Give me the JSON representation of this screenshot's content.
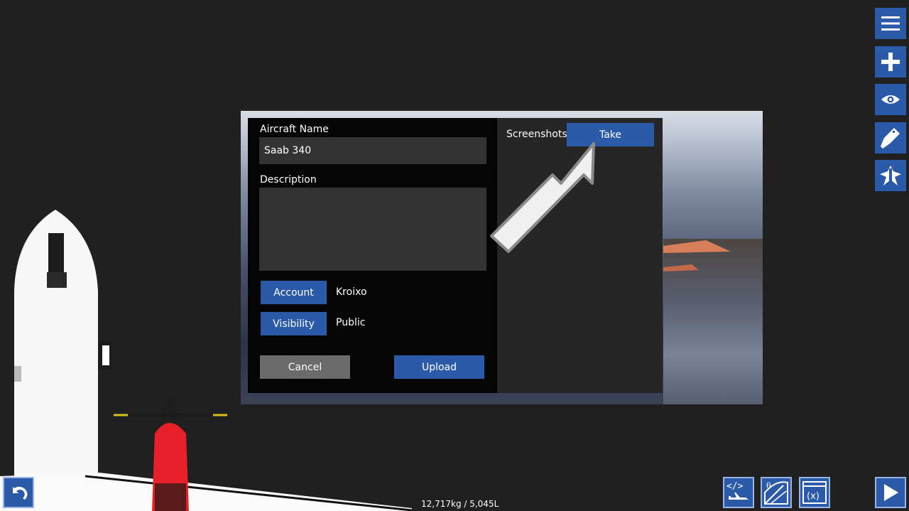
{
  "dialog": {
    "aircraft_name_label": "Aircraft Name",
    "aircraft_name_value": "Saab 340",
    "description_label": "Description",
    "description_value": "",
    "account_button": "Account",
    "account_value": "Kroixo",
    "visibility_button": "Visibility",
    "visibility_value": "Public",
    "cancel_button": "Cancel",
    "upload_button": "Upload",
    "screenshots_label": "Screenshots",
    "take_button": "Take"
  },
  "toolbar": {
    "items": [
      "menu-icon",
      "add-part-icon",
      "view-icon",
      "paint-icon",
      "wing-icon"
    ]
  },
  "bottom": {
    "mass_readout": "12,717kg / 5,045L",
    "tools": [
      "undo-icon",
      "xml-edit-icon",
      "flight-instruments-icon",
      "variables-icon",
      "play-icon"
    ]
  },
  "colors": {
    "accent": "#2a5aa8",
    "background": "#202020",
    "panel": "#050505",
    "field": "#333333"
  }
}
